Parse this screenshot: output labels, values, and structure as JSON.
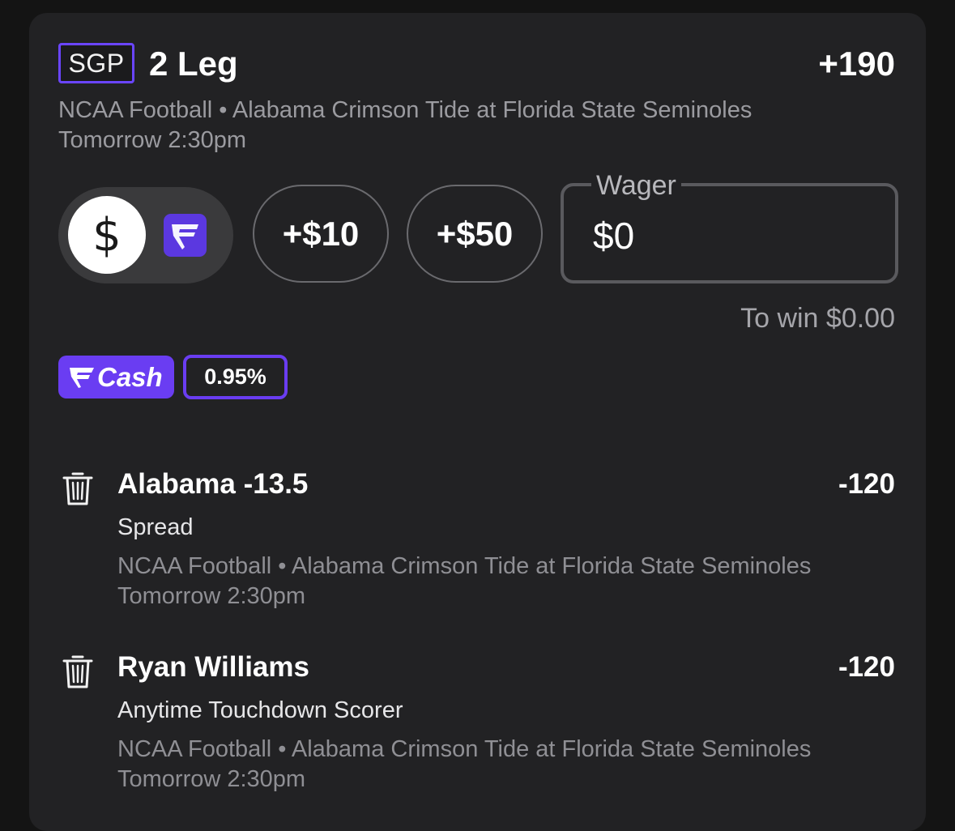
{
  "header": {
    "badge": "SGP",
    "title": "2 Leg",
    "odds": "+190",
    "event": "NCAA Football • Alabama Crimson Tide at Florida State Seminoles",
    "time": "Tomorrow 2:30pm"
  },
  "currency": {
    "cash_symbol": "$",
    "cash_icon": "dollar-icon",
    "fc_icon": "fanduel-shield-icon"
  },
  "quick_add": [
    "+$10",
    "+$50"
  ],
  "wager": {
    "label": "Wager",
    "value": "$0"
  },
  "to_win": "To win $0.00",
  "fcash": {
    "label": "Cash",
    "rate": "0.95%",
    "accent": "#6a3df2"
  },
  "legs": [
    {
      "selection": "Alabama -13.5",
      "odds": "-120",
      "market": "Spread",
      "event": "NCAA Football • Alabama Crimson Tide at Florida State Seminoles",
      "time": "Tomorrow 2:30pm"
    },
    {
      "selection": "Ryan Williams",
      "odds": "-120",
      "market": "Anytime Touchdown Scorer",
      "event": "NCAA Football • Alabama Crimson Tide at Florida State Seminoles",
      "time": "Tomorrow 2:30pm"
    }
  ],
  "colors": {
    "background": "#141414",
    "card": "#222224",
    "accent": "#6a45ff"
  }
}
